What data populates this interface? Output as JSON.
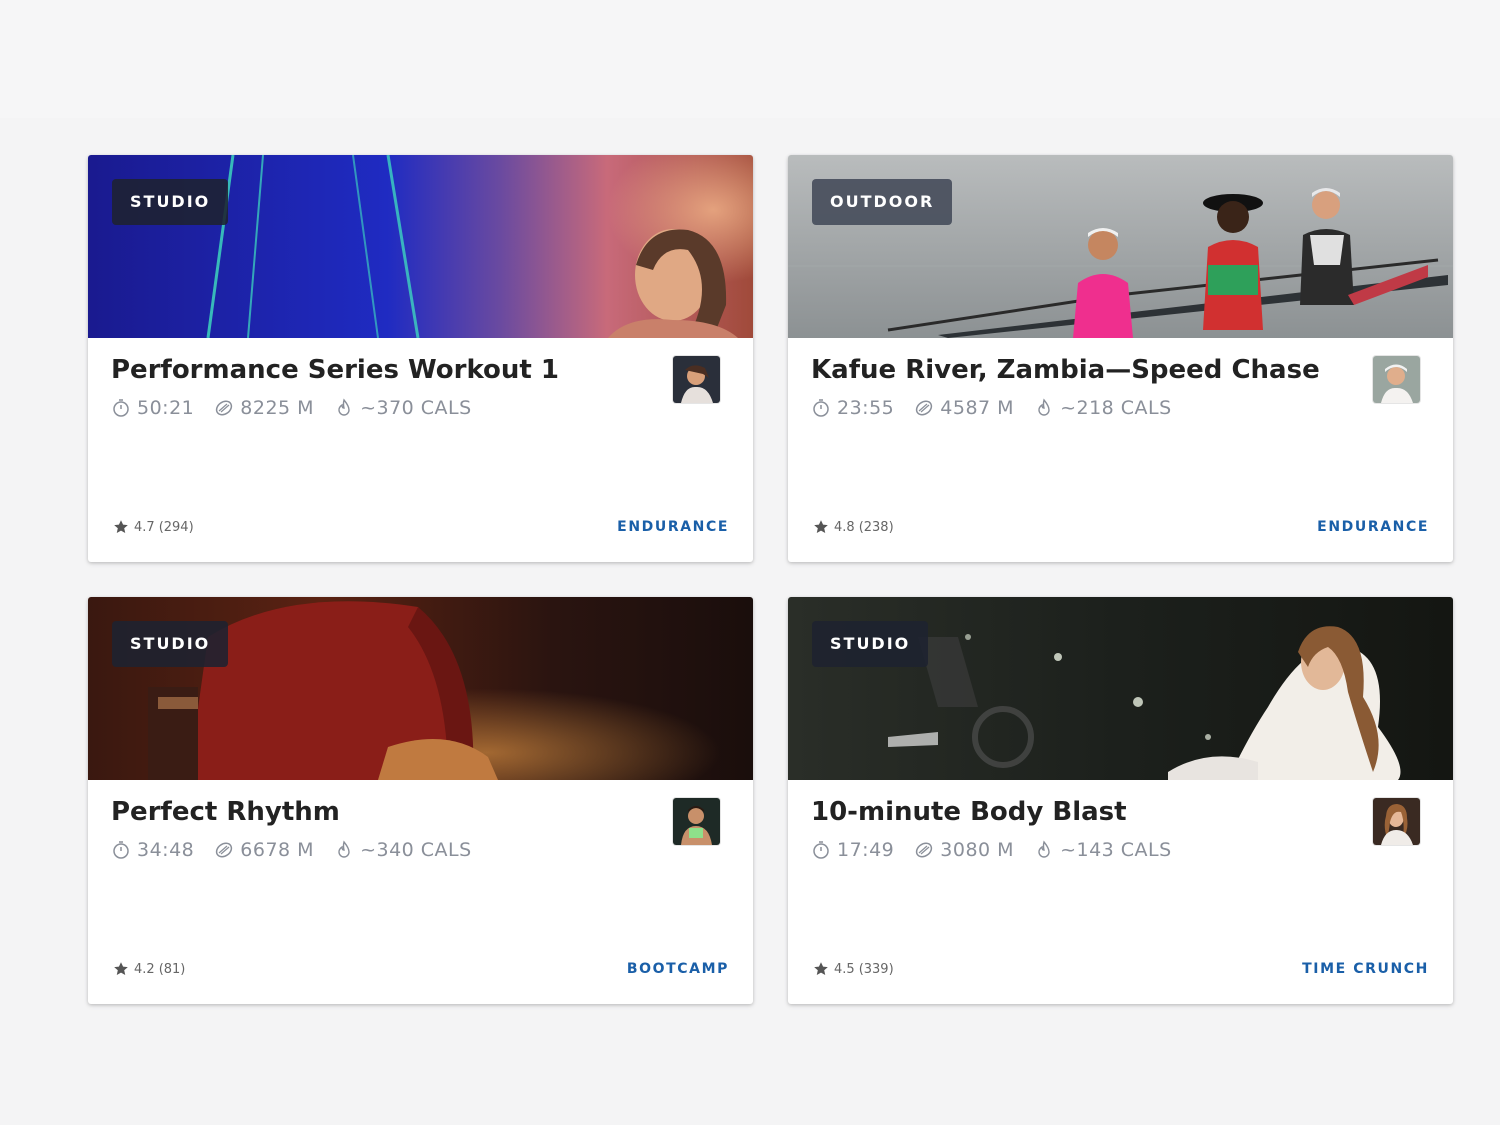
{
  "cards": [
    {
      "badge": "STUDIO",
      "title": "Performance Series Workout 1",
      "duration": "50:21",
      "distance": "8225 M",
      "calories": "~370 CALS",
      "rating": "4.7",
      "rating_count": "(294)",
      "category": "ENDURANCE"
    },
    {
      "badge": "OUTDOOR",
      "title": "Kafue River, Zambia—Speed Chase",
      "duration": "23:55",
      "distance": "4587 M",
      "calories": "~218 CALS",
      "rating": "4.8",
      "rating_count": "(238)",
      "category": "ENDURANCE"
    },
    {
      "badge": "STUDIO",
      "title": "Perfect Rhythm",
      "duration": "34:48",
      "distance": "6678 M",
      "calories": "~340 CALS",
      "rating": "4.2",
      "rating_count": "(81)",
      "category": "BOOTCAMP"
    },
    {
      "badge": "STUDIO",
      "title": "10-minute Body Blast",
      "duration": "17:49",
      "distance": "3080 M",
      "calories": "~143 CALS",
      "rating": "4.5",
      "rating_count": "(339)",
      "category": "TIME CRUNCH"
    }
  ],
  "icons": {
    "duration": "stopwatch-icon",
    "distance": "distance-icon",
    "calories": "flame-icon",
    "rating": "star-icon"
  },
  "colors": {
    "category": "#1a5fa8",
    "stat_text": "#8a8f99",
    "badge_bg": "#1e2230"
  }
}
